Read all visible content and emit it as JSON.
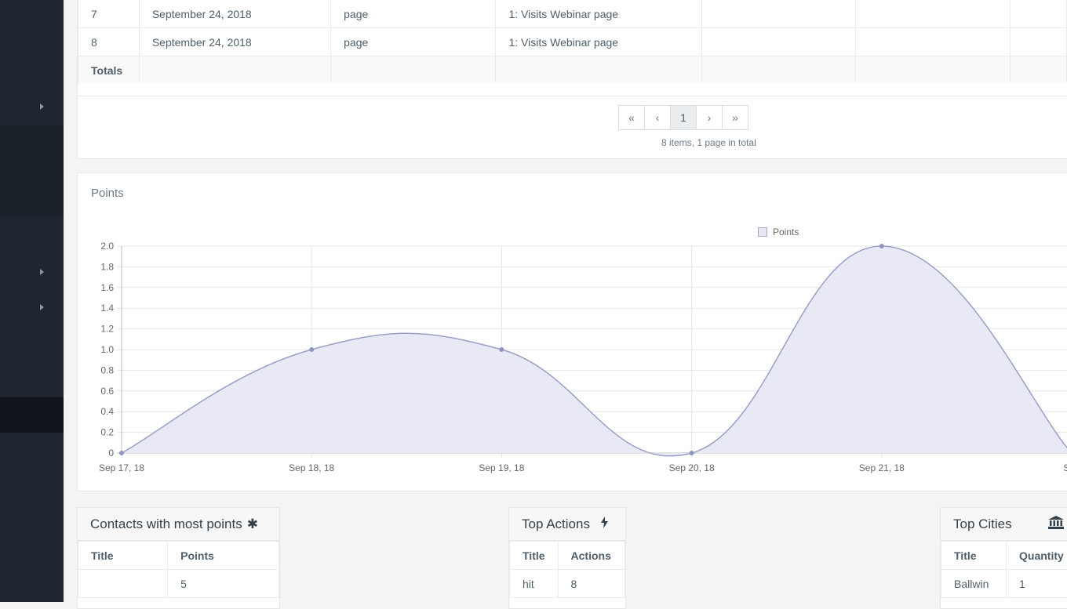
{
  "events_table": {
    "rows": [
      {
        "num": "7",
        "date": "September 24, 2018",
        "type": "page",
        "event": "1: Visits Webinar page"
      },
      {
        "num": "8",
        "date": "September 24, 2018",
        "type": "page",
        "event": "1: Visits Webinar page"
      }
    ],
    "totals_label": "Totals"
  },
  "pagination": {
    "first": "«",
    "prev": "‹",
    "current": "1",
    "next": "›",
    "last": "»",
    "info": "8 items, 1 page in total"
  },
  "points_panel": {
    "title": "Points"
  },
  "chart_data": {
    "type": "area",
    "x": [
      "Sep 17, 18",
      "Sep 18, 18",
      "Sep 19, 18",
      "Sep 20, 18",
      "Sep 21, 18",
      "Sep"
    ],
    "series": [
      {
        "name": "Points",
        "values": [
          0,
          1,
          1,
          0,
          2,
          0
        ]
      }
    ],
    "ylim": [
      0,
      2
    ],
    "yticks": [
      "0",
      "0.2",
      "0.4",
      "0.6",
      "0.8",
      "1.0",
      "1.2",
      "1.4",
      "1.6",
      "1.8",
      "2.0"
    ],
    "grid": true,
    "legend": "top",
    "colors": {
      "line": "#9a9fc8",
      "fill": "#e9e9f5"
    }
  },
  "contacts_card": {
    "title": "Contacts with most points",
    "icon": "asterisk-icon",
    "headers": [
      "Title",
      "Points"
    ],
    "rows": [
      [
        "",
        "5"
      ]
    ]
  },
  "actions_card": {
    "title": "Top Actions",
    "icon": "bolt-icon",
    "headers": [
      "Title",
      "Actions"
    ],
    "rows": [
      [
        "hit",
        "8"
      ]
    ]
  },
  "cities_card": {
    "title": "Top Cities",
    "icon": "bank-icon",
    "headers": [
      "Title",
      "Quantity"
    ],
    "rows": [
      [
        "Ballwin",
        "1"
      ]
    ]
  }
}
